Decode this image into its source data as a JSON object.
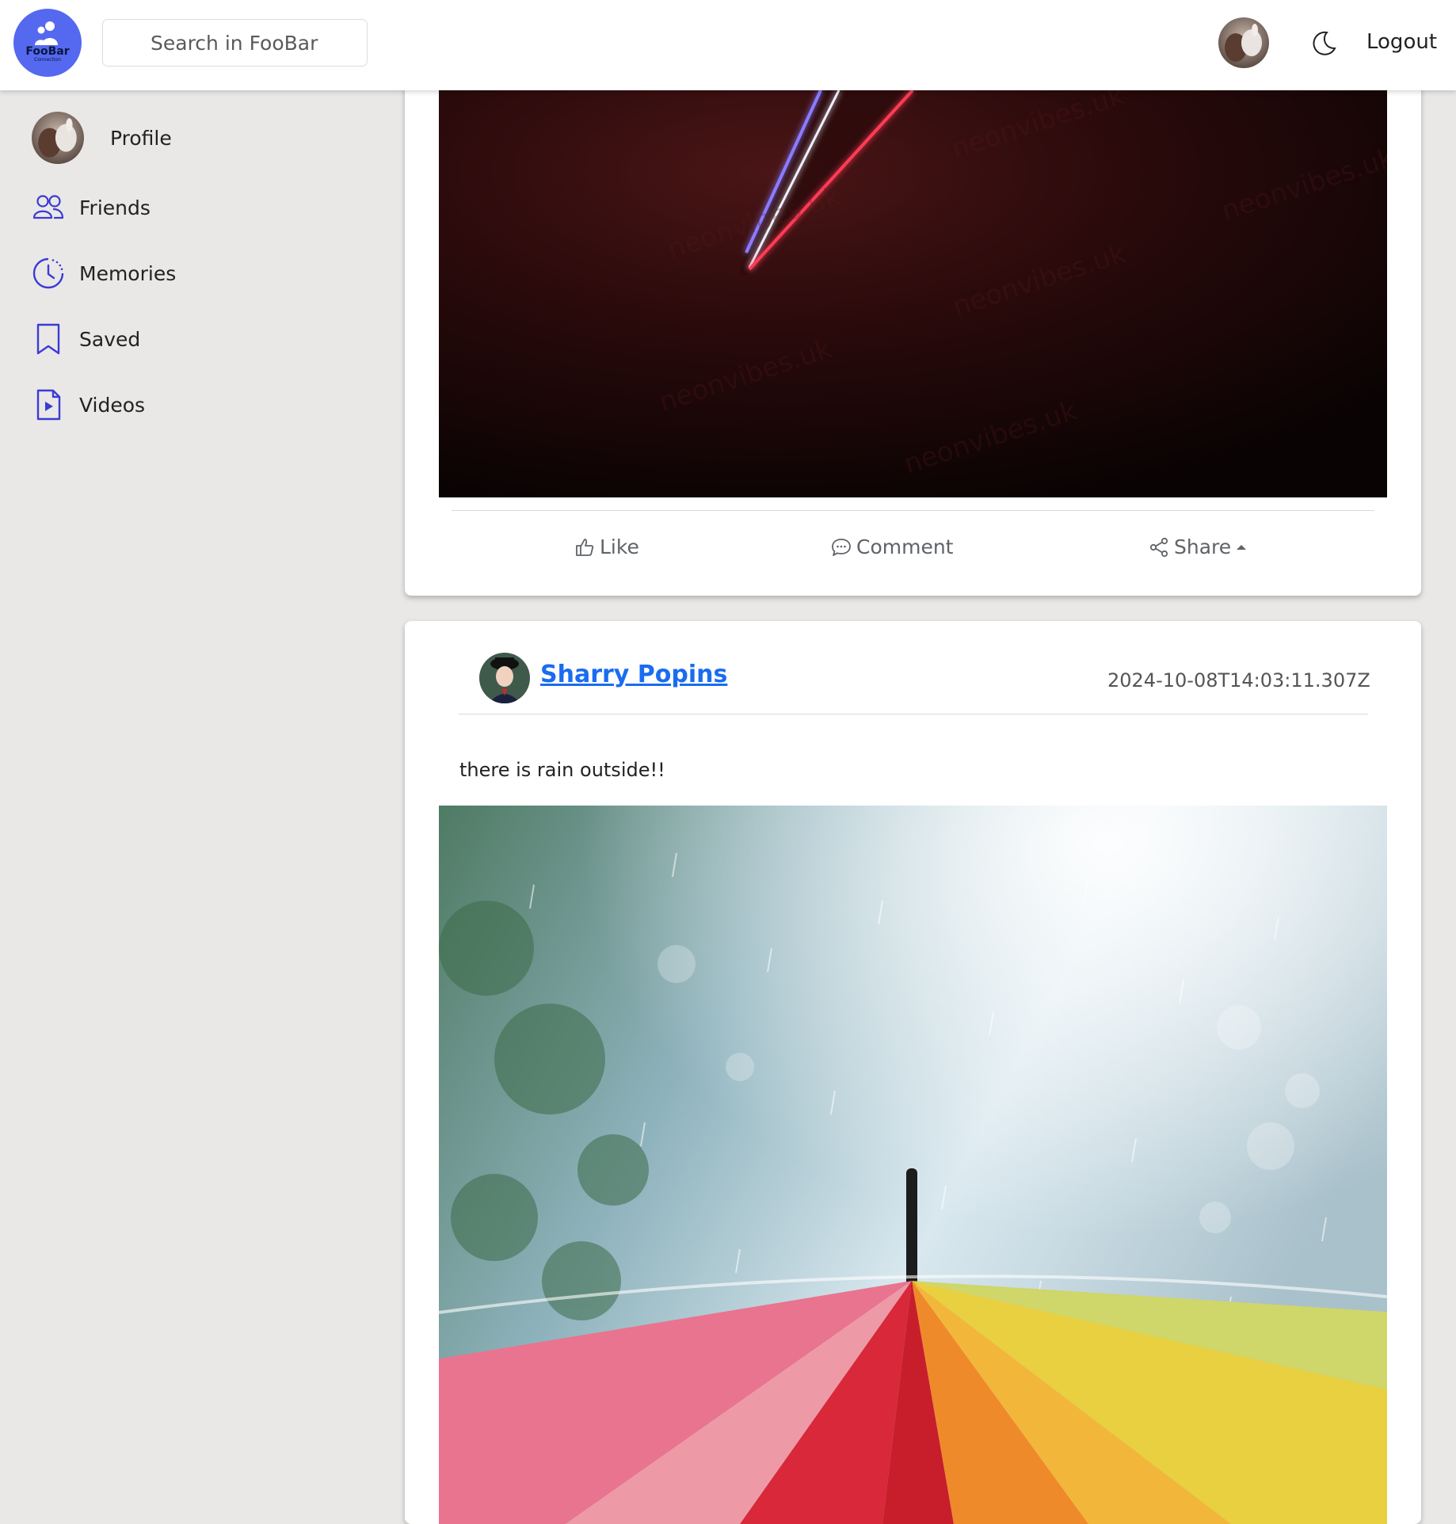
{
  "app": {
    "logo_title": "FooBar",
    "logo_subtitle": "Connection"
  },
  "header": {
    "search_placeholder": "Search in FooBar",
    "logout_label": "Logout",
    "icons": [
      "moon-icon"
    ]
  },
  "sidebar": {
    "items": [
      {
        "label": "Profile",
        "icon": "avatar"
      },
      {
        "label": "Friends",
        "icon": "friends-icon"
      },
      {
        "label": "Memories",
        "icon": "clock-icon"
      },
      {
        "label": "Saved",
        "icon": "bookmark-icon"
      },
      {
        "label": "Videos",
        "icon": "video-file-icon"
      }
    ]
  },
  "posts": [
    {
      "actions": {
        "like_label": "Like",
        "comment_label": "Comment",
        "share_label": "Share"
      },
      "image_watermark": "neonvibes.uk"
    },
    {
      "author": "Sharry Popins",
      "timestamp": "2024-10-08T14:03:11.307Z",
      "text": "there is rain outside!!"
    }
  ],
  "colors": {
    "accent": "#1a6cf0",
    "logo_bg": "#5469ef",
    "icon": "#3b3bd4",
    "page_bg": "#e9e8e7"
  }
}
